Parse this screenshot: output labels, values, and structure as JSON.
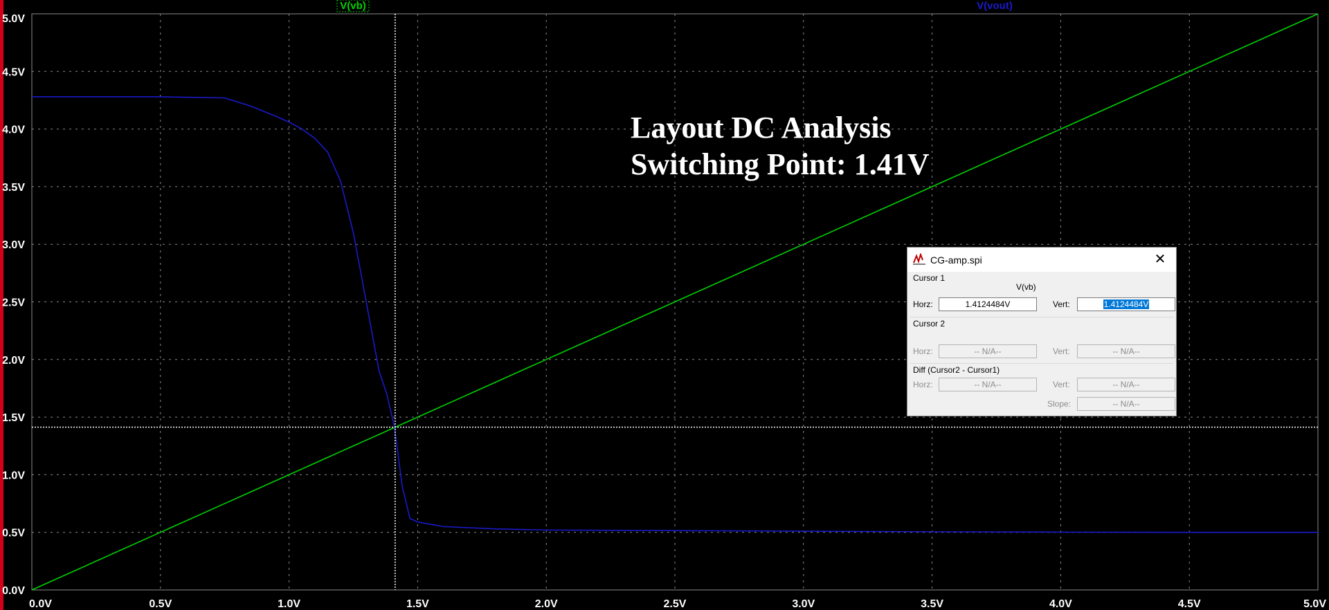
{
  "colors": {
    "background": "#000000",
    "grid": "#8c8c8c",
    "trace_vb": "#00d400",
    "trace_vout": "#1a1acc",
    "cursor": "#ffffff",
    "text": "#ffffff"
  },
  "chart_data": {
    "type": "line",
    "x": [
      0.0,
      0.5,
      0.75,
      0.85,
      0.95,
      1.0,
      1.05,
      1.1,
      1.15,
      1.2,
      1.25,
      1.3,
      1.35,
      1.38,
      1.41,
      1.44,
      1.47,
      1.5,
      1.6,
      1.8,
      2.0,
      2.5,
      3.0,
      3.5,
      4.0,
      4.5,
      5.0
    ],
    "series": [
      {
        "name": "V(vb)",
        "color": "#00d400",
        "values": [
          0.0,
          0.5,
          0.75,
          0.85,
          0.95,
          1.0,
          1.05,
          1.1,
          1.15,
          1.2,
          1.25,
          1.3,
          1.35,
          1.38,
          1.41,
          1.44,
          1.47,
          1.5,
          1.6,
          1.8,
          2.0,
          2.5,
          3.0,
          3.5,
          4.0,
          4.5,
          5.0
        ]
      },
      {
        "name": "V(vout)",
        "color": "#1a1acc",
        "values": [
          4.28,
          4.28,
          4.27,
          4.2,
          4.11,
          4.06,
          4.0,
          3.92,
          3.8,
          3.55,
          3.1,
          2.5,
          1.9,
          1.7,
          1.41,
          0.9,
          0.62,
          0.59,
          0.55,
          0.53,
          0.52,
          0.515,
          0.51,
          0.505,
          0.502,
          0.5,
          0.5
        ]
      }
    ],
    "xlim": [
      0,
      5
    ],
    "ylim": [
      0,
      5
    ],
    "x_ticks": [
      "0.0V",
      "0.5V",
      "1.0V",
      "1.5V",
      "2.0V",
      "2.5V",
      "3.0V",
      "3.5V",
      "4.0V",
      "4.5V",
      "5.0V"
    ],
    "y_ticks": [
      "0.0V",
      "0.5V",
      "1.0V",
      "1.5V",
      "2.0V",
      "2.5V",
      "3.0V",
      "3.5V",
      "4.0V",
      "4.5V",
      "5.0V"
    ],
    "grid": true,
    "cursor": {
      "x": 1.4124484,
      "y": 1.4124484
    },
    "annotation": [
      "Layout DC Analysis",
      "Switching Point: 1.41V"
    ]
  },
  "dialog": {
    "title": "CG-amp.spi",
    "close": "✕",
    "cursor1_label": "Cursor 1",
    "cursor1_trace": "V(vb)",
    "horz_label": "Horz:",
    "vert_label": "Vert:",
    "cursor1_horz": "1.4124484V",
    "cursor1_vert": "1.4124484V",
    "cursor2_label": "Cursor 2",
    "cursor2_horz": "-- N/A--",
    "cursor2_vert": "-- N/A--",
    "diff_label": "Diff (Cursor2 - Cursor1)",
    "diff_horz": "-- N/A--",
    "diff_vert": "-- N/A--",
    "slope_label": "Slope:",
    "diff_slope": "-- N/A--"
  }
}
